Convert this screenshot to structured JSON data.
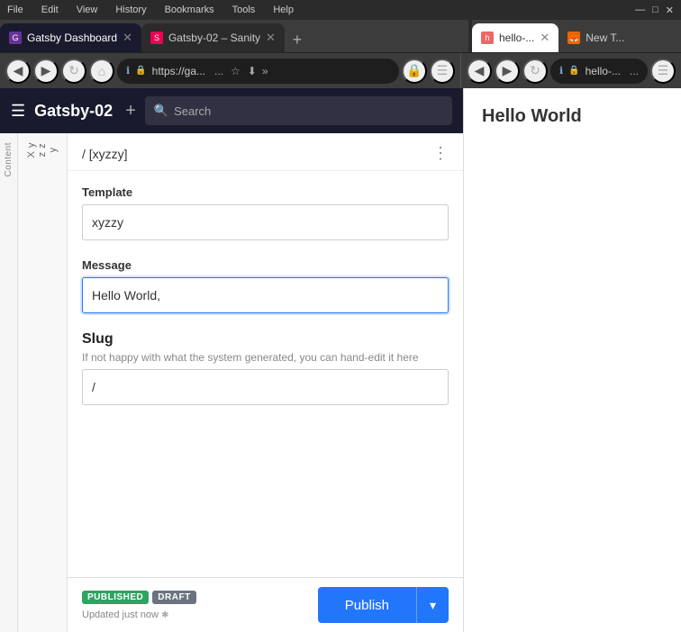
{
  "browser": {
    "tabs_left": [
      {
        "id": "gatsby",
        "label": "Gatsby Dashboard",
        "favicon_type": "gatsby",
        "active": true
      },
      {
        "id": "sanity",
        "label": "Gatsby-02 – Sanity",
        "favicon_type": "sanity",
        "active": false
      }
    ],
    "tabs_right": [
      {
        "id": "hello",
        "label": "hello-...",
        "active": true
      },
      {
        "id": "new",
        "label": "New Tab",
        "active": false
      }
    ],
    "nav": {
      "url": "https://ga...",
      "more_btn": "...",
      "back_disabled": true,
      "forward_disabled": true
    }
  },
  "cms": {
    "title": "Gatsby-02",
    "search_placeholder": "Search",
    "side_label_content": "Content",
    "sidebar_labels": [
      "X y z z y"
    ],
    "doc_path": "/ [xyzzy]",
    "template_label": "Template",
    "template_value": "xyzzy",
    "message_label": "Message",
    "message_value": "Hello World,",
    "message_cursor": true,
    "slug_label": "Slug",
    "slug_hint": "If not happy with what the system generated, you can hand-edit it here",
    "slug_value": "/",
    "status_published": "PUBLISHED",
    "status_draft": "DRAFT",
    "updated_text": "Updated just now",
    "publish_btn": "Publish"
  },
  "preview": {
    "title": "Hello World",
    "url": "hello-..."
  }
}
